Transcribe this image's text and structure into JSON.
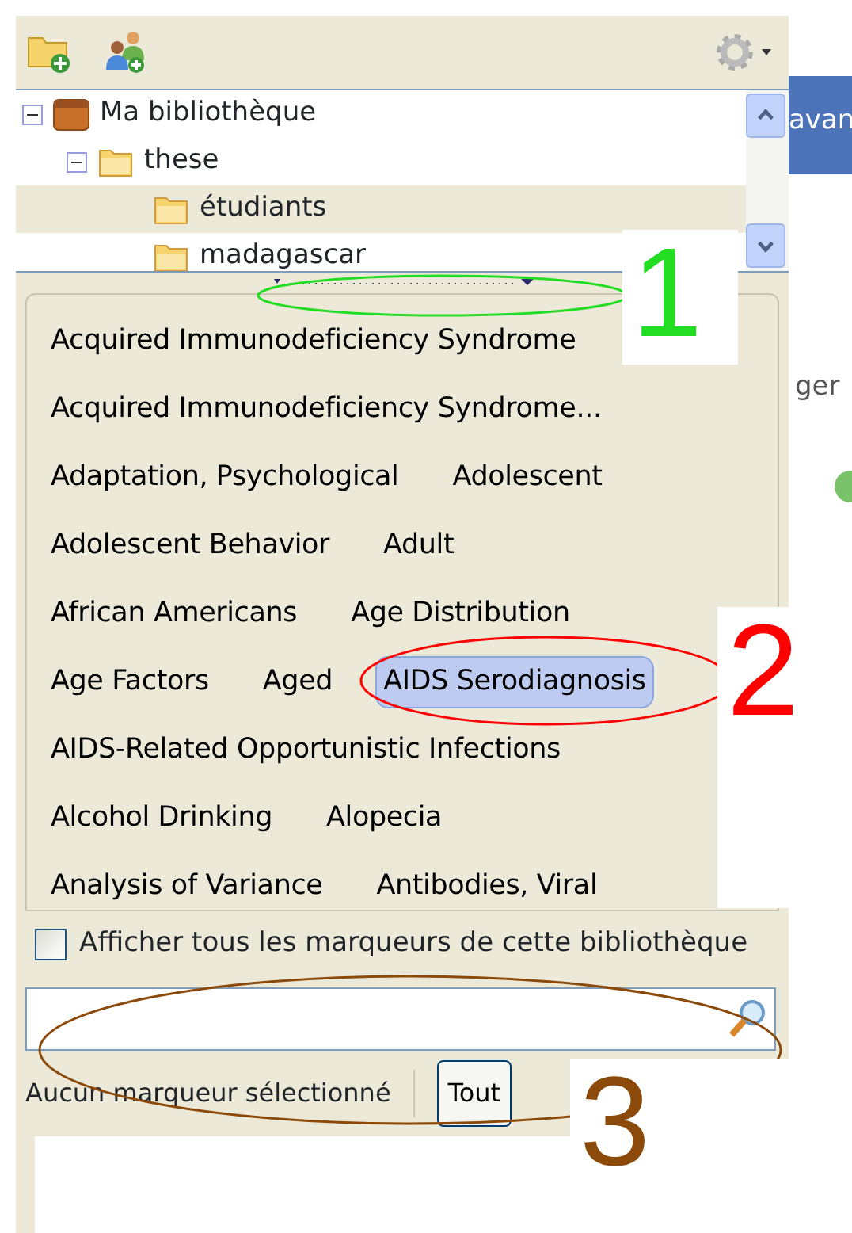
{
  "toolbar": {
    "buttons": [
      {
        "kind": "new-collection"
      },
      {
        "kind": "new-group"
      }
    ],
    "actions_menu": {
      "kind": "gear"
    }
  },
  "collections": [
    {
      "label": "Ma bibliothèque",
      "kind": "library",
      "expanded": true,
      "selected": false,
      "children": [
        {
          "label": "these",
          "kind": "folder",
          "expanded": true,
          "selected": false,
          "children": [
            {
              "label": "étudiants",
              "kind": "folder",
              "selected": true
            },
            {
              "label": "madagascar",
              "kind": "folder",
              "selected": false
            }
          ]
        }
      ]
    }
  ],
  "tag_rows": [
    [
      {
        "label": "Acquired Immunodeficiency Syndrome",
        "selected": false
      }
    ],
    [
      {
        "label": "Acquired Immunodeficiency Syndrome...",
        "selected": false
      }
    ],
    [
      {
        "label": "Adaptation, Psychological",
        "selected": false
      },
      {
        "label": "Adolescent",
        "selected": false
      }
    ],
    [
      {
        "label": "Adolescent Behavior",
        "selected": false
      },
      {
        "label": "Adult",
        "selected": false
      }
    ],
    [
      {
        "label": "African Americans",
        "selected": false
      },
      {
        "label": "Age Distribution",
        "selected": false
      }
    ],
    [
      {
        "label": "Age Factors",
        "selected": false
      },
      {
        "label": "Aged",
        "selected": false
      },
      {
        "label": "AIDS Serodiagnosis",
        "selected": true
      }
    ],
    [
      {
        "label": "AIDS-Related Opportunistic Infections",
        "selected": false
      }
    ],
    [
      {
        "label": "Alcohol Drinking",
        "selected": false
      },
      {
        "label": "Alopecia",
        "selected": false
      }
    ],
    [
      {
        "label": "Analysis of Variance",
        "selected": false
      },
      {
        "label": "Antibodies, Viral",
        "selected": false
      }
    ]
  ],
  "show_all": {
    "label": "Afficher tous les marqueurs de cette bibliothèque",
    "checked": false
  },
  "status": {
    "text": "Aucun marqueur sélectionné",
    "button": "Tout"
  },
  "right_pane": {
    "header": "avan",
    "field_text": "ger"
  },
  "annotations": [
    {
      "number": "1",
      "color": "#22dd22"
    },
    {
      "number": "2",
      "color": "#ff0000"
    },
    {
      "number": "3",
      "color": "#8b4a0a"
    }
  ]
}
